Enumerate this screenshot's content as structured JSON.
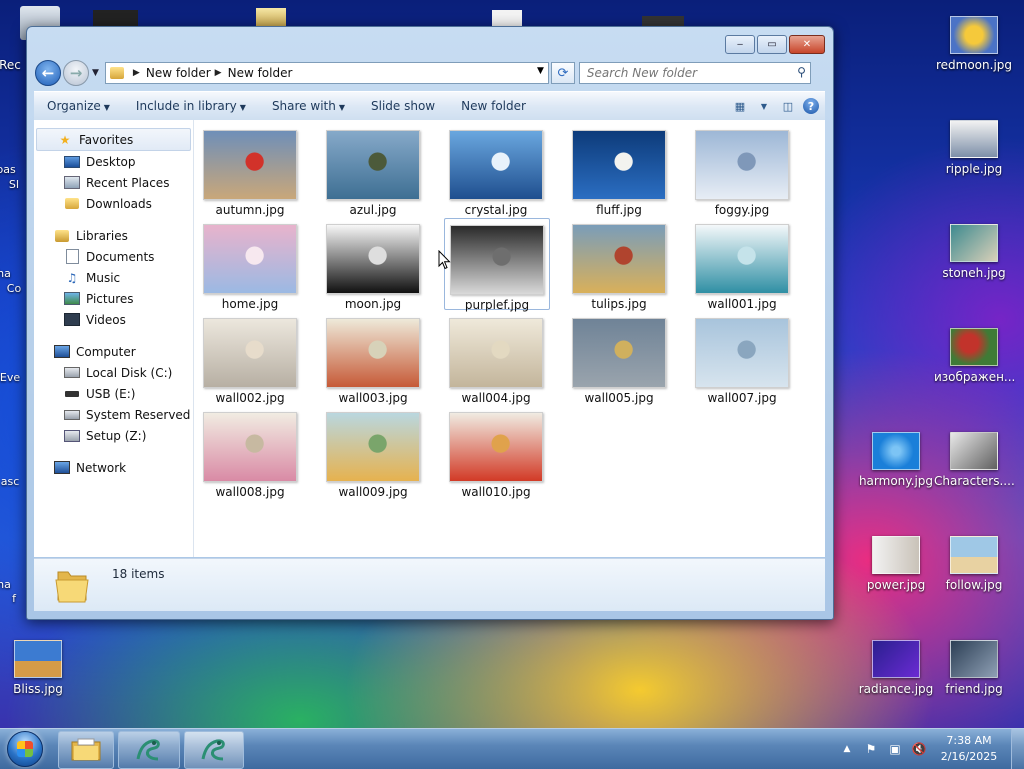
{
  "window": {
    "address_segments": [
      "New folder",
      "New folder"
    ],
    "search_placeholder": "Search New folder",
    "caption_minimize": "‒",
    "caption_maximize": "▭",
    "caption_close": "✕"
  },
  "toolbar": {
    "organize": "Organize",
    "include_in_library": "Include in library",
    "share_with": "Share with",
    "slide_show": "Slide show",
    "new_folder": "New folder"
  },
  "nav": {
    "favorites": "Favorites",
    "desktop": "Desktop",
    "recent_places": "Recent Places",
    "downloads": "Downloads",
    "libraries": "Libraries",
    "documents": "Documents",
    "music": "Music",
    "pictures": "Pictures",
    "videos": "Videos",
    "computer": "Computer",
    "local_disk": "Local Disk (C:)",
    "usb": "USB (E:)",
    "system_reserved": "System Reserved (F:)",
    "setup": "Setup (Z:)",
    "network": "Network"
  },
  "files": [
    {
      "name": "autumn.jpg",
      "c1": "#6f8fb8",
      "c2": "#c9a77a",
      "c3": "#d2322a"
    },
    {
      "name": "azul.jpg",
      "c1": "#86a9c9",
      "c2": "#3e6f93",
      "c3": "#4c5a3a"
    },
    {
      "name": "crystal.jpg",
      "c1": "#6aa7df",
      "c2": "#1f4f8f",
      "c3": "#e8f2fb"
    },
    {
      "name": "fluff.jpg",
      "c1": "#0d3b7a",
      "c2": "#2b6ec2",
      "c3": "#f3f3ef"
    },
    {
      "name": "foggy.jpg",
      "c1": "#9db7d6",
      "c2": "#e7edf5",
      "c3": "#7f98b9"
    },
    {
      "name": "home.jpg",
      "c1": "#e8b3cc",
      "c2": "#9bb9e3",
      "c3": "#f7e8ef"
    },
    {
      "name": "moon.jpg",
      "c1": "#f7f7f7",
      "c2": "#101010",
      "c3": "#dedede"
    },
    {
      "name": "purplef.jpg",
      "c1": "#2a2a2a",
      "c2": "#d9d9d9",
      "c3": "#6e6e6e"
    },
    {
      "name": "tulips.jpg",
      "c1": "#7a9db9",
      "c2": "#d9b05a",
      "c3": "#b0442e"
    },
    {
      "name": "wall001.jpg",
      "c1": "#f4f8fa",
      "c2": "#2f8fa4",
      "c3": "#c5e3ea"
    },
    {
      "name": "wall002.jpg",
      "c1": "#ece7dd",
      "c2": "#b7afa3",
      "c3": "#e7dccb"
    },
    {
      "name": "wall003.jpg",
      "c1": "#eee9d9",
      "c2": "#c65a37",
      "c3": "#d7d2b9"
    },
    {
      "name": "wall004.jpg",
      "c1": "#efe9da",
      "c2": "#c3b59b",
      "c3": "#e3d9c1"
    },
    {
      "name": "wall005.jpg",
      "c1": "#6f8397",
      "c2": "#9aa4ad",
      "c3": "#d0b05e"
    },
    {
      "name": "wall007.jpg",
      "c1": "#a8c4dc",
      "c2": "#d7e4ee",
      "c3": "#8aa6bf"
    },
    {
      "name": "wall008.jpg",
      "c1": "#f1ece2",
      "c2": "#d98aa5",
      "c3": "#c7b9a1"
    },
    {
      "name": "wall009.jpg",
      "c1": "#b9d7df",
      "c2": "#e6b24f",
      "c3": "#7aa56b"
    },
    {
      "name": "wall010.jpg",
      "c1": "#f0ebe2",
      "c2": "#d23a26",
      "c3": "#e0a24c"
    }
  ],
  "status": {
    "item_count": "18 items"
  },
  "desktop_icons": [
    {
      "label": "redmoon.jpg",
      "c1": "#e9b22a",
      "c2": "#5a7bc8"
    },
    {
      "label": "ripple.jpg",
      "c1": "#f2f2f2",
      "c2": "#7d8fa8"
    },
    {
      "label": "stoneh.jpg",
      "c1": "#3d8a8f",
      "c2": "#d9d0b9"
    },
    {
      "label": "изображен...",
      "c1": "#c2332b",
      "c2": "#3f7b36"
    },
    {
      "label": "harmony.jpg",
      "c1": "#1a7fd9",
      "c2": "#7cc4f5"
    },
    {
      "label": "Characters....",
      "c1": "#e8e8e8",
      "c2": "#606060"
    },
    {
      "label": "power.jpg",
      "c1": "#f2f2f2",
      "c2": "#c9c2b8"
    },
    {
      "label": "follow.jpg",
      "c1": "#9fc8e6",
      "c2": "#e8d2a2"
    },
    {
      "label": "radiance.jpg",
      "c1": "#2a1f8f",
      "c2": "#6a2bd3"
    },
    {
      "label": "friend.jpg",
      "c1": "#2c3f55",
      "c2": "#8fa0b5"
    },
    {
      "label": "Bliss.jpg",
      "c1": "#3c7bd1",
      "c2": "#d59b47"
    }
  ],
  "desktop_partial_labels": [
    "Rec",
    "bas",
    "SI",
    "ha",
    "Co",
    "Eve",
    "asc",
    "ha",
    "f"
  ],
  "taskbar": {
    "time": "7:38 AM",
    "date": "2/16/2025"
  }
}
